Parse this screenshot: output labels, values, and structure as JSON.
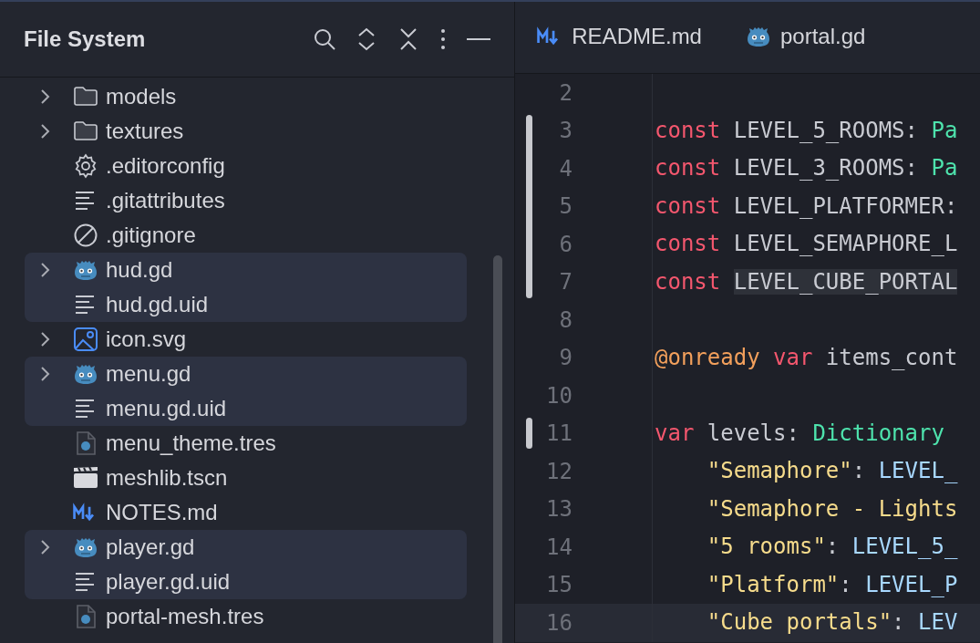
{
  "file_system": {
    "title": "File System",
    "items": [
      {
        "kind": "folder",
        "name": "models",
        "expandable": true
      },
      {
        "kind": "folder",
        "name": "textures",
        "expandable": true
      },
      {
        "kind": "gear",
        "name": ".editorconfig",
        "expandable": false
      },
      {
        "kind": "text",
        "name": ".gitattributes",
        "expandable": false
      },
      {
        "kind": "ignore",
        "name": ".gitignore",
        "expandable": false
      },
      {
        "kind": "group",
        "items": [
          {
            "kind": "script",
            "name": "hud.gd",
            "expandable": true
          },
          {
            "kind": "text",
            "name": "hud.gd.uid",
            "expandable": false
          }
        ]
      },
      {
        "kind": "image",
        "name": "icon.svg",
        "expandable": true
      },
      {
        "kind": "group",
        "items": [
          {
            "kind": "script",
            "name": "menu.gd",
            "expandable": true
          },
          {
            "kind": "text",
            "name": "menu.gd.uid",
            "expandable": false
          }
        ]
      },
      {
        "kind": "resource",
        "name": "menu_theme.tres",
        "expandable": false
      },
      {
        "kind": "scene",
        "name": "meshlib.tscn",
        "expandable": false
      },
      {
        "kind": "markdown",
        "name": "NOTES.md",
        "expandable": false
      },
      {
        "kind": "group",
        "items": [
          {
            "kind": "script",
            "name": "player.gd",
            "expandable": true
          },
          {
            "kind": "text",
            "name": "player.gd.uid",
            "expandable": false
          }
        ]
      },
      {
        "kind": "resource",
        "name": "portal-mesh.tres",
        "expandable": false
      }
    ]
  },
  "editor": {
    "tabs": [
      {
        "kind": "markdown",
        "label": "README.md",
        "selected": false
      },
      {
        "kind": "script",
        "label": "portal.gd",
        "selected": false
      }
    ],
    "lines": [
      {
        "number": "2",
        "changed": false,
        "current": false
      },
      {
        "number": "3",
        "changed": true,
        "current": false,
        "tokens": [
          {
            "kind": "keyword",
            "text": "const"
          },
          {
            "kind": "plain",
            "text": " LEVEL_5_ROOMS: "
          },
          {
            "kind": "type",
            "text": "Pa"
          }
        ]
      },
      {
        "number": "4",
        "changed": true,
        "current": false,
        "tokens": [
          {
            "kind": "keyword",
            "text": "const"
          },
          {
            "kind": "plain",
            "text": " LEVEL_3_ROOMS: "
          },
          {
            "kind": "type",
            "text": "Pa"
          }
        ]
      },
      {
        "number": "5",
        "changed": true,
        "current": false,
        "tokens": [
          {
            "kind": "keyword",
            "text": "const"
          },
          {
            "kind": "plain",
            "text": " LEVEL_PLATFORMER:"
          }
        ]
      },
      {
        "number": "6",
        "changed": true,
        "current": false,
        "tokens": [
          {
            "kind": "keyword",
            "text": "const"
          },
          {
            "kind": "plain",
            "text": " LEVEL_SEMAPHORE_L"
          }
        ]
      },
      {
        "number": "7",
        "changed": true,
        "current": false,
        "tokens": [
          {
            "kind": "keyword",
            "text": "const "
          },
          {
            "kind": "plain",
            "text": "LEVEL_CUBE_PORTAL",
            "highlighted": true
          }
        ]
      },
      {
        "number": "8",
        "changed": false,
        "current": false
      },
      {
        "number": "9",
        "changed": false,
        "current": false,
        "tokens": [
          {
            "kind": "annotation",
            "text": "@onready "
          },
          {
            "kind": "keyword",
            "text": "var"
          },
          {
            "kind": "plain",
            "text": " items_cont"
          }
        ]
      },
      {
        "number": "10",
        "changed": false,
        "current": false
      },
      {
        "number": "11",
        "changed": true,
        "current": false,
        "tokens": [
          {
            "kind": "keyword",
            "text": "var"
          },
          {
            "kind": "plain",
            "text": " levels: "
          },
          {
            "kind": "type",
            "text": "Dictionary"
          }
        ]
      },
      {
        "number": "12",
        "changed": false,
        "current": false,
        "tokens": [
          {
            "kind": "string",
            "text": "    \"Semaphore\""
          },
          {
            "kind": "plain",
            "text": ": "
          },
          {
            "kind": "constant",
            "text": "LEVEL_"
          }
        ]
      },
      {
        "number": "13",
        "changed": false,
        "current": false,
        "tokens": [
          {
            "kind": "string",
            "text": "    \"Semaphore - Lights"
          }
        ]
      },
      {
        "number": "14",
        "changed": false,
        "current": false,
        "tokens": [
          {
            "kind": "string",
            "text": "    \"5 rooms\""
          },
          {
            "kind": "plain",
            "text": ": "
          },
          {
            "kind": "constant",
            "text": "LEVEL_5_"
          }
        ]
      },
      {
        "number": "15",
        "changed": false,
        "current": false,
        "tokens": [
          {
            "kind": "string",
            "text": "    \"Platform\""
          },
          {
            "kind": "plain",
            "text": ": "
          },
          {
            "kind": "constant",
            "text": "LEVEL_P"
          }
        ]
      },
      {
        "number": "16",
        "changed": false,
        "current": true,
        "tokens": [
          {
            "kind": "string",
            "text": "    \"Cube portals\""
          },
          {
            "kind": "plain",
            "text": ": "
          },
          {
            "kind": "constant",
            "text": "LEV"
          }
        ]
      }
    ]
  }
}
